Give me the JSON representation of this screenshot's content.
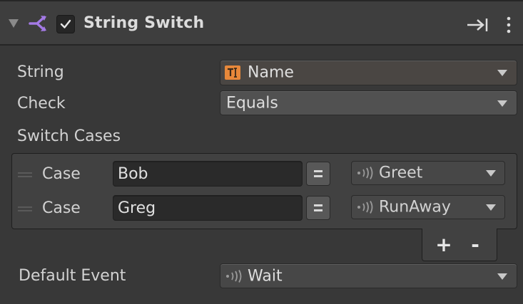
{
  "header": {
    "title": "String Switch",
    "enabled": true,
    "icons": {
      "foldout": "foldout-arrow-icon",
      "node": "branch-switch-icon",
      "collapse": "collapse-to-edge-icon",
      "menu": "kebab-menu-icon"
    },
    "accent_color": "#a47ae6"
  },
  "fields": {
    "string_label": "String",
    "string_value": "Name",
    "string_icon": "text-variable-icon",
    "check_label": "Check",
    "check_value": "Equals",
    "switch_cases_label": "Switch Cases",
    "default_event_label": "Default Event",
    "default_event_value": "Wait"
  },
  "cases": [
    {
      "label": "Case",
      "value": "Bob",
      "event": "Greet"
    },
    {
      "label": "Case",
      "value": "Greg",
      "event": "RunAway"
    }
  ],
  "list_controls": {
    "add": "+",
    "remove": "-"
  }
}
